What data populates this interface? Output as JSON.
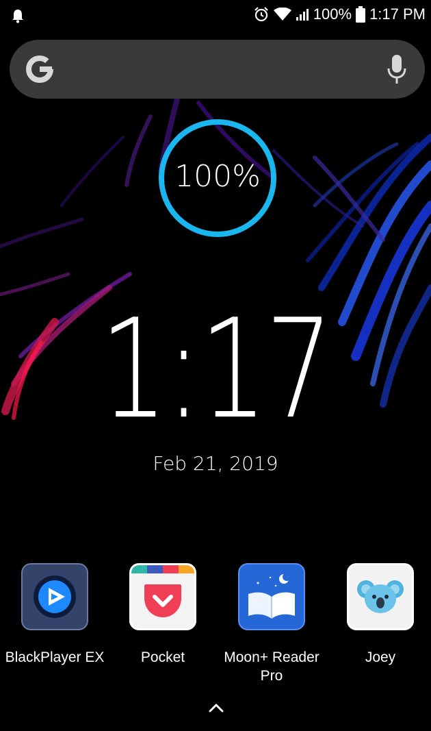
{
  "status_bar": {
    "icons": [
      "notification-bell-icon",
      "alarm-icon",
      "wifi-icon",
      "signal-icon",
      "battery-icon"
    ],
    "battery": "100%",
    "time": "1:17 PM"
  },
  "search_bar": {
    "left_icon": "google-g-icon",
    "right_icon": "microphone-icon"
  },
  "widget": {
    "battery_level": "100%",
    "battery_fraction": 1.0,
    "ring_color": "#1ab6f0",
    "clock": "1:17",
    "date": "Feb 21, 2019"
  },
  "dock": {
    "apps": [
      {
        "label": "BlackPlayer EX",
        "icon": "blackplayer-icon"
      },
      {
        "label": "Pocket",
        "icon": "pocket-icon"
      },
      {
        "label": "Moon+ Reader Pro",
        "icon": "moon-reader-icon"
      },
      {
        "label": "Joey",
        "icon": "joey-koala-icon"
      }
    ],
    "drawer_icon": "chevron-up-icon"
  }
}
